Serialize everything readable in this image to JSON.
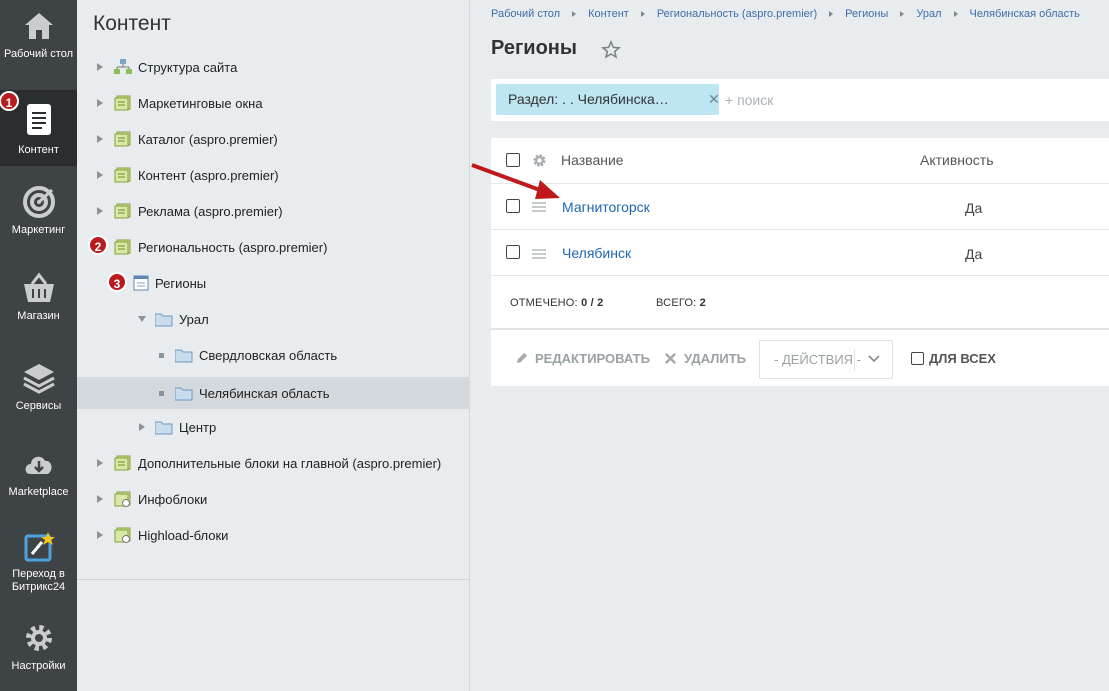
{
  "rail": {
    "items": [
      {
        "label": "Рабочий стол",
        "icon": "home-icon"
      },
      {
        "label": "Контент",
        "icon": "document-icon"
      },
      {
        "label": "Маркетинг",
        "icon": "target-icon"
      },
      {
        "label": "Магазин",
        "icon": "basket-icon"
      },
      {
        "label": "Сервисы",
        "icon": "layers-icon"
      },
      {
        "label": "Marketplace",
        "icon": "cloud-download-icon"
      },
      {
        "label": "Переход в Битрикс24",
        "icon": "bitrix24-icon"
      },
      {
        "label": "Настройки",
        "icon": "gear-icon"
      }
    ]
  },
  "badges": [
    "1",
    "2",
    "3"
  ],
  "tree": {
    "title": "Контент",
    "items": [
      {
        "label": "Структура сайта"
      },
      {
        "label": "Маркетинговые окна"
      },
      {
        "label": "Каталог (aspro.premier)"
      },
      {
        "label": "Контент (aspro.premier)"
      },
      {
        "label": "Реклама (aspro.premier)"
      },
      {
        "label": "Региональность (aspro.premier)"
      },
      {
        "label": "Регионы"
      },
      {
        "label": "Урал"
      },
      {
        "label": "Свердловская область"
      },
      {
        "label": "Челябинская область"
      },
      {
        "label": "Центр"
      },
      {
        "label": "Дополнительные блоки на главной (aspro.premier)"
      },
      {
        "label": "Инфоблоки"
      },
      {
        "label": "Highload-блоки"
      }
    ]
  },
  "breadcrumbs": [
    "Рабочий стол",
    "Контент",
    "Региональность (aspro.premier)",
    "Регионы",
    "Урал",
    "Челябинская область"
  ],
  "page": {
    "title": "Регионы"
  },
  "filter": {
    "chip": "Раздел: . . Челябинска…",
    "search_placeholder": "+ поиск"
  },
  "grid": {
    "columns": {
      "name": "Название",
      "active": "Активность"
    },
    "rows": [
      {
        "name": "Магнитогорск",
        "active": "Да"
      },
      {
        "name": "Челябинск",
        "active": "Да"
      }
    ],
    "footer": {
      "selected_label": "ОТМЕЧЕНО:",
      "selected_value": "0 / 2",
      "total_label": "ВСЕГО:",
      "total_value": "2"
    },
    "actions": {
      "edit": "Редактировать",
      "delete": "Удалить",
      "dropdown": "- ДЕЙСТВИЯ -",
      "for_all": "ДЛЯ ВСЕХ"
    }
  },
  "colors": {
    "rail_bg": "#3e4346",
    "link": "#2067b0",
    "badge": "#b81c1c",
    "chip": "#bde5f2",
    "arrow": "#c0191b"
  }
}
